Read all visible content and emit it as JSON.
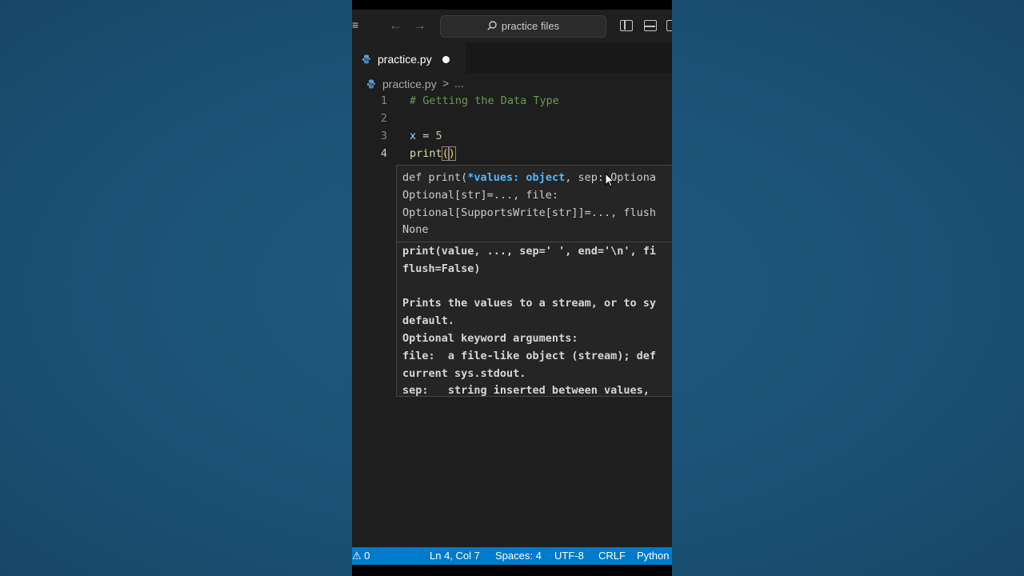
{
  "window": {
    "search_text": "practice files",
    "icons": [
      "menu-icon",
      "arrow-left-icon",
      "arrow-right-icon",
      "search-icon",
      "toggle-sidebar-icon",
      "toggle-panel-icon"
    ]
  },
  "tab": {
    "filename": "practice.py",
    "modified": true
  },
  "breadcrumb": {
    "file": "practice.py",
    "separator": ">",
    "more": "..."
  },
  "editor": {
    "lines": [
      {
        "number": "1",
        "text": "# Getting the Data Type"
      },
      {
        "number": "2",
        "text": ""
      },
      {
        "number": "3",
        "var": "x",
        "op": " = ",
        "num": "5"
      },
      {
        "number": "4",
        "fn": "print",
        "open": "(",
        "close": ")"
      }
    ]
  },
  "hover": {
    "sig_prefix": "def print(",
    "sig_param": "*values: object",
    "sig_rest_1": ", sep: Optiona",
    "sig_line2": "Optional[str]=..., file:",
    "sig_line3": "Optional[SupportsWrite[str]]=..., flush",
    "sig_line4": "None",
    "doc_lines": [
      "print(value, ..., sep=' ', end='\\n', fi",
      "flush=False)",
      "",
      "Prints the values to a stream, or to sy",
      "default.",
      "Optional keyword arguments:",
      "file:  a file-like object (stream); def",
      "current sys.stdout.",
      "sep:   string inserted between values,"
    ]
  },
  "status": {
    "problems": "⚠ 0",
    "position": "Ln 4, Col 7",
    "spaces": "Spaces: 4",
    "encoding": "UTF-8",
    "eol": "CRLF",
    "language": "Python"
  },
  "colors": {
    "status_bar": "#007acc",
    "editor_bg": "#1e1e1e",
    "background": "#1b5175"
  }
}
